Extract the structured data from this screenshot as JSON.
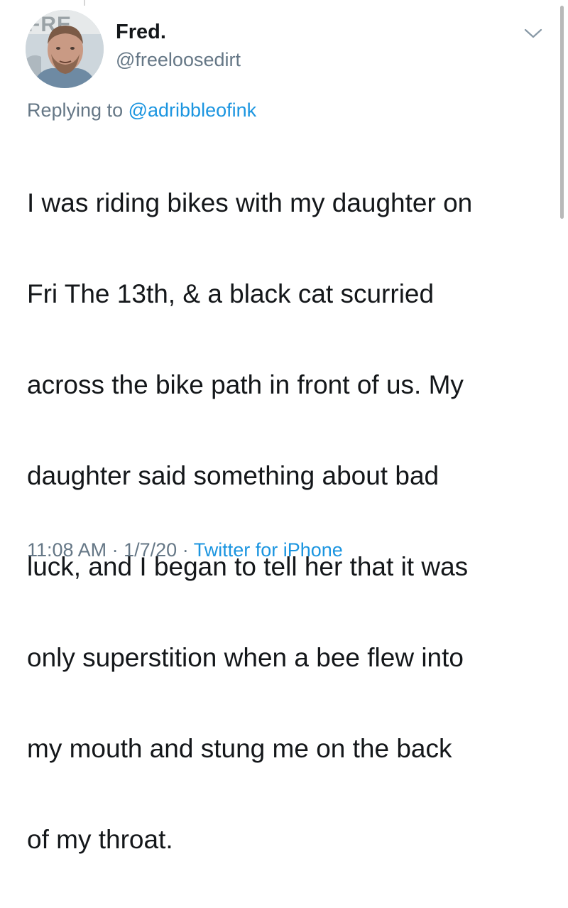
{
  "author": {
    "display_name": "Fred.",
    "handle": "@freeloosedirt",
    "avatar_logo_text": "FRE"
  },
  "reply": {
    "prefix": "Replying to",
    "mention": "@adribbleofink"
  },
  "tweet": {
    "lines": [
      "I was riding bikes with my daughter on",
      "Fri The 13th, & a black cat scurried",
      "across the bike path in front of us. My",
      "daughter said something about bad",
      "luck, and I began to tell her that it was",
      "only superstition when a bee flew into",
      "my mouth and stung me on the back",
      "of my throat."
    ]
  },
  "meta": {
    "time": "11:08 AM",
    "separator": "·",
    "date": "1/7/20",
    "source": "Twitter for iPhone"
  },
  "icons": {
    "more": "chevron-down-icon",
    "avatar": "profile-photo"
  },
  "colors": {
    "text": "#14171a",
    "secondary": "#657786",
    "link": "#1b95e0"
  }
}
